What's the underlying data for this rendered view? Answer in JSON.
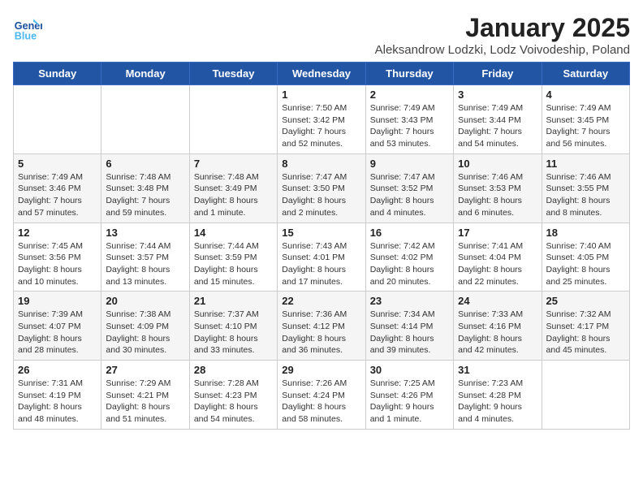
{
  "header": {
    "logo_general": "General",
    "logo_blue": "Blue",
    "title": "January 2025",
    "subtitle": "Aleksandrow Lodzki, Lodz Voivodeship, Poland"
  },
  "weekdays": [
    "Sunday",
    "Monday",
    "Tuesday",
    "Wednesday",
    "Thursday",
    "Friday",
    "Saturday"
  ],
  "weeks": [
    [
      {
        "day": "",
        "info": ""
      },
      {
        "day": "",
        "info": ""
      },
      {
        "day": "",
        "info": ""
      },
      {
        "day": "1",
        "info": "Sunrise: 7:50 AM\nSunset: 3:42 PM\nDaylight: 7 hours\nand 52 minutes."
      },
      {
        "day": "2",
        "info": "Sunrise: 7:49 AM\nSunset: 3:43 PM\nDaylight: 7 hours\nand 53 minutes."
      },
      {
        "day": "3",
        "info": "Sunrise: 7:49 AM\nSunset: 3:44 PM\nDaylight: 7 hours\nand 54 minutes."
      },
      {
        "day": "4",
        "info": "Sunrise: 7:49 AM\nSunset: 3:45 PM\nDaylight: 7 hours\nand 56 minutes."
      }
    ],
    [
      {
        "day": "5",
        "info": "Sunrise: 7:49 AM\nSunset: 3:46 PM\nDaylight: 7 hours\nand 57 minutes."
      },
      {
        "day": "6",
        "info": "Sunrise: 7:48 AM\nSunset: 3:48 PM\nDaylight: 7 hours\nand 59 minutes."
      },
      {
        "day": "7",
        "info": "Sunrise: 7:48 AM\nSunset: 3:49 PM\nDaylight: 8 hours\nand 1 minute."
      },
      {
        "day": "8",
        "info": "Sunrise: 7:47 AM\nSunset: 3:50 PM\nDaylight: 8 hours\nand 2 minutes."
      },
      {
        "day": "9",
        "info": "Sunrise: 7:47 AM\nSunset: 3:52 PM\nDaylight: 8 hours\nand 4 minutes."
      },
      {
        "day": "10",
        "info": "Sunrise: 7:46 AM\nSunset: 3:53 PM\nDaylight: 8 hours\nand 6 minutes."
      },
      {
        "day": "11",
        "info": "Sunrise: 7:46 AM\nSunset: 3:55 PM\nDaylight: 8 hours\nand 8 minutes."
      }
    ],
    [
      {
        "day": "12",
        "info": "Sunrise: 7:45 AM\nSunset: 3:56 PM\nDaylight: 8 hours\nand 10 minutes."
      },
      {
        "day": "13",
        "info": "Sunrise: 7:44 AM\nSunset: 3:57 PM\nDaylight: 8 hours\nand 13 minutes."
      },
      {
        "day": "14",
        "info": "Sunrise: 7:44 AM\nSunset: 3:59 PM\nDaylight: 8 hours\nand 15 minutes."
      },
      {
        "day": "15",
        "info": "Sunrise: 7:43 AM\nSunset: 4:01 PM\nDaylight: 8 hours\nand 17 minutes."
      },
      {
        "day": "16",
        "info": "Sunrise: 7:42 AM\nSunset: 4:02 PM\nDaylight: 8 hours\nand 20 minutes."
      },
      {
        "day": "17",
        "info": "Sunrise: 7:41 AM\nSunset: 4:04 PM\nDaylight: 8 hours\nand 22 minutes."
      },
      {
        "day": "18",
        "info": "Sunrise: 7:40 AM\nSunset: 4:05 PM\nDaylight: 8 hours\nand 25 minutes."
      }
    ],
    [
      {
        "day": "19",
        "info": "Sunrise: 7:39 AM\nSunset: 4:07 PM\nDaylight: 8 hours\nand 28 minutes."
      },
      {
        "day": "20",
        "info": "Sunrise: 7:38 AM\nSunset: 4:09 PM\nDaylight: 8 hours\nand 30 minutes."
      },
      {
        "day": "21",
        "info": "Sunrise: 7:37 AM\nSunset: 4:10 PM\nDaylight: 8 hours\nand 33 minutes."
      },
      {
        "day": "22",
        "info": "Sunrise: 7:36 AM\nSunset: 4:12 PM\nDaylight: 8 hours\nand 36 minutes."
      },
      {
        "day": "23",
        "info": "Sunrise: 7:34 AM\nSunset: 4:14 PM\nDaylight: 8 hours\nand 39 minutes."
      },
      {
        "day": "24",
        "info": "Sunrise: 7:33 AM\nSunset: 4:16 PM\nDaylight: 8 hours\nand 42 minutes."
      },
      {
        "day": "25",
        "info": "Sunrise: 7:32 AM\nSunset: 4:17 PM\nDaylight: 8 hours\nand 45 minutes."
      }
    ],
    [
      {
        "day": "26",
        "info": "Sunrise: 7:31 AM\nSunset: 4:19 PM\nDaylight: 8 hours\nand 48 minutes."
      },
      {
        "day": "27",
        "info": "Sunrise: 7:29 AM\nSunset: 4:21 PM\nDaylight: 8 hours\nand 51 minutes."
      },
      {
        "day": "28",
        "info": "Sunrise: 7:28 AM\nSunset: 4:23 PM\nDaylight: 8 hours\nand 54 minutes."
      },
      {
        "day": "29",
        "info": "Sunrise: 7:26 AM\nSunset: 4:24 PM\nDaylight: 8 hours\nand 58 minutes."
      },
      {
        "day": "30",
        "info": "Sunrise: 7:25 AM\nSunset: 4:26 PM\nDaylight: 9 hours\nand 1 minute."
      },
      {
        "day": "31",
        "info": "Sunrise: 7:23 AM\nSunset: 4:28 PM\nDaylight: 9 hours\nand 4 minutes."
      },
      {
        "day": "",
        "info": ""
      }
    ]
  ]
}
